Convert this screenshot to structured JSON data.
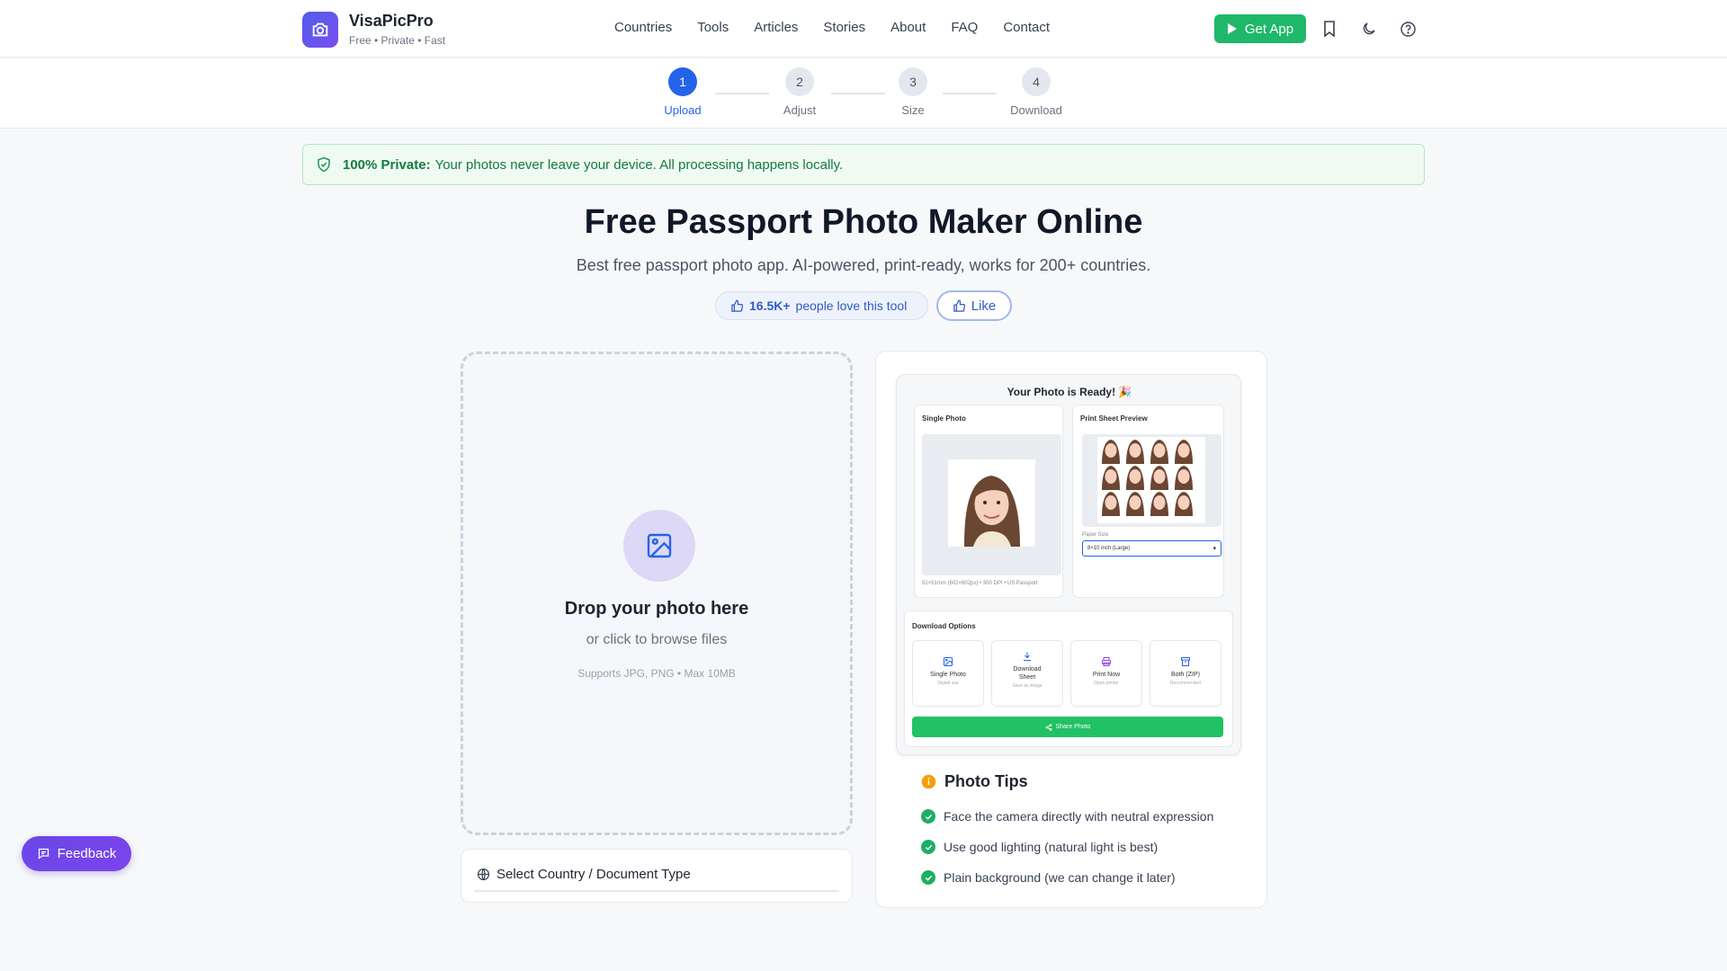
{
  "brand": {
    "name": "VisaPicPro",
    "tagline": "Free • Private • Fast"
  },
  "nav": [
    "Countries",
    "Tools",
    "Articles",
    "Stories",
    "About",
    "FAQ",
    "Contact"
  ],
  "header": {
    "get_app": "Get App",
    "icons": [
      "bookmark-icon",
      "moon-icon",
      "help-icon"
    ]
  },
  "steps": [
    {
      "num": "1",
      "label": "Upload",
      "active": true
    },
    {
      "num": "2",
      "label": "Adjust",
      "active": false
    },
    {
      "num": "3",
      "label": "Size",
      "active": false
    },
    {
      "num": "4",
      "label": "Download",
      "active": false
    }
  ],
  "privacy": {
    "bold": "100% Private:",
    "text": "Your photos never leave your device. All processing happens locally."
  },
  "hero": {
    "title": "Free Passport Photo Maker Online",
    "subtitle": "Best free passport photo app. AI-powered, print-ready, works for 200+ countries."
  },
  "social": {
    "count": "16.5K+",
    "text": "people love this tool",
    "like": "Like"
  },
  "upload": {
    "title": "Drop your photo here",
    "subtitle": "or click to browse files",
    "note": "Supports JPG, PNG • Max 10MB"
  },
  "country": {
    "label": "Select Country / Document Type"
  },
  "preview": {
    "title": "Your Photo is Ready! 🎉",
    "single_title": "Single Photo",
    "single_caption": "51×51mm (602×602px) • 300 DPI • US Passport",
    "sheet_title": "Print Sheet Preview",
    "paper_label": "Paper Size",
    "paper_value": "8×10 inch (Large)",
    "download_title": "Download Options",
    "options": [
      {
        "title": "Single Photo",
        "sub": "Digital use",
        "icon": "image-icon"
      },
      {
        "title": "Download Sheet",
        "sub": "Save as image",
        "icon": "download-icon"
      },
      {
        "title": "Print Now",
        "sub": "Open printer",
        "icon": "printer-icon"
      },
      {
        "title": "Both (ZIP)",
        "sub": "Recommended",
        "icon": "archive-icon"
      }
    ],
    "share": "Share Photo"
  },
  "tips": {
    "title": "Photo Tips",
    "items": [
      "Face the camera directly with neutral expression",
      "Use good lighting (natural light is best)",
      "Plain background (we can change it later)"
    ]
  },
  "feedback": "Feedback",
  "colors": {
    "primary": "#2563eb",
    "green": "#1fb86a",
    "purple": "#6a46e8"
  }
}
